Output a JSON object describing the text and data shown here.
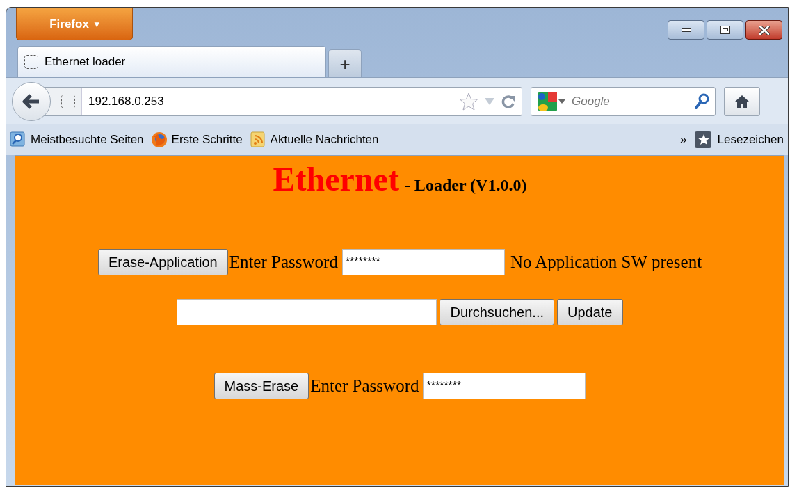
{
  "app_button": {
    "label": "Firefox",
    "caret": "▾"
  },
  "tabs": [
    {
      "title": "Ethernet loader",
      "selected": true
    }
  ],
  "new_tab": "+",
  "url": "192.168.0.253",
  "search": {
    "placeholder": "Google"
  },
  "bookmarks": [
    {
      "label": "Meistbesuchte Seiten",
      "kind": "search"
    },
    {
      "label": "Erste Schritte",
      "kind": "globe"
    },
    {
      "label": "Aktuelle Nachrichten",
      "kind": "feed"
    }
  ],
  "bookmarks_overflow": "»",
  "bookmarks_menu": "Lesezeichen",
  "page": {
    "title": "Ethernet",
    "subtitle": "- Loader (V1.0.0)",
    "erase_app": {
      "button": "Erase-Application",
      "label": "Enter Password",
      "password": "********",
      "status": "No Application SW present"
    },
    "upload": {
      "browse": "Durchsuchen...",
      "update": "Update"
    },
    "mass_erase": {
      "button": "Mass-Erase",
      "label": "Enter Password",
      "password": "********"
    }
  }
}
